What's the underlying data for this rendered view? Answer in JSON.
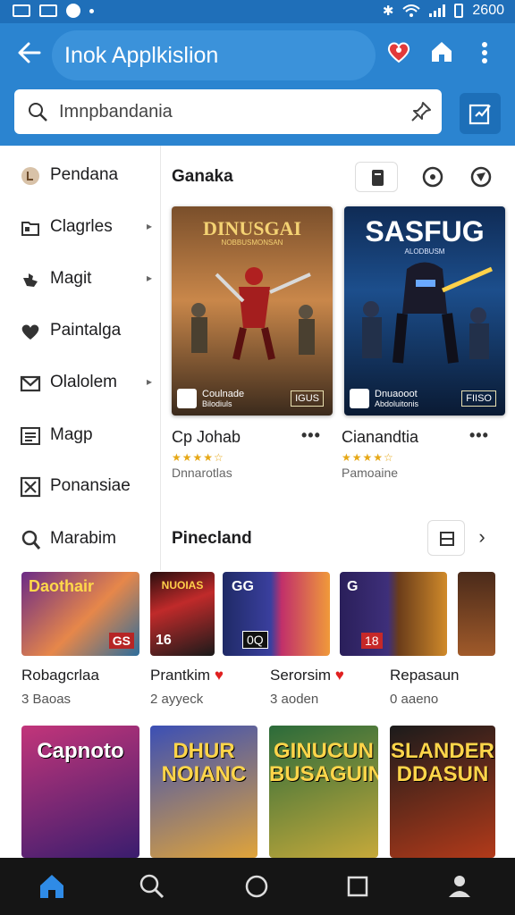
{
  "status_bar": {
    "time": "2600"
  },
  "app_bar": {
    "title": "Inok Applkislion"
  },
  "search": {
    "placeholder": "Imnpbandania"
  },
  "sidebar": {
    "items": [
      {
        "label": "Pendana",
        "icon": "circle-badge-icon",
        "chevron": false
      },
      {
        "label": "Clagrles",
        "icon": "folder-icon",
        "chevron": true
      },
      {
        "label": "Magit",
        "icon": "puzzle-icon",
        "chevron": true
      },
      {
        "label": "Paintalga",
        "icon": "heart-icon",
        "chevron": false
      },
      {
        "label": "Olalolem",
        "icon": "mail-icon",
        "chevron": true
      },
      {
        "label": "Magp",
        "icon": "list-icon",
        "chevron": false
      },
      {
        "label": "Ponansiae",
        "icon": "close-box-icon",
        "chevron": false
      },
      {
        "label": "Marabim",
        "icon": "user-search-icon",
        "chevron": false
      }
    ]
  },
  "section_1": {
    "title": "Ganaka",
    "cards": [
      {
        "art_title": "DINUSGAI",
        "art_subtitle": "NOBBUSMONSAN",
        "badge": "Coulnade",
        "badge_sub": "Bilodiuls",
        "tag": "IGUS",
        "name": "Cp Johab",
        "rating": 4.5,
        "sub": "Dnnarotlas",
        "icon": "warrior-art"
      },
      {
        "art_title": "SASFUG",
        "art_subtitle": "ALODBUSM",
        "badge": "Dnuaooot",
        "badge_sub": "Abdoluitonis",
        "tag": "FIISO",
        "name": "Cianandtia",
        "rating": 4.5,
        "sub": "Pamoaine",
        "icon": "assassin-art"
      }
    ]
  },
  "section_2": {
    "title": "Pinecland",
    "items": [
      {
        "label": "Robagcrlaa",
        "sub": "3 Baoas",
        "heart": false,
        "art_title": "Daothair",
        "tag": "GS"
      },
      {
        "label": "Prantkim",
        "sub": "2 ayyeck",
        "heart": true,
        "art_title": "NUOIAS",
        "tag": "16"
      },
      {
        "label": "Serorsim",
        "sub": "3 aoden",
        "heart": true,
        "art_title": "GG",
        "tag": "0Q"
      },
      {
        "label": "Repasaun",
        "sub": "0 aaeno",
        "heart": false,
        "art_title": "G",
        "tag": "18"
      }
    ]
  },
  "posters": [
    {
      "title": "Capnoto",
      "colors": [
        "#c2357a",
        "#3a1d6e"
      ]
    },
    {
      "title": "DHUR NOIANC",
      "colors": [
        "#3b4fb5",
        "#e0a43a"
      ]
    },
    {
      "title": "GINUCUN BUSAGUIN",
      "colors": [
        "#2b6b3a",
        "#c6a93a"
      ]
    },
    {
      "title": "SLANDER DDASUN",
      "colors": [
        "#1b1b1b",
        "#b23a1a"
      ]
    }
  ],
  "nav": {
    "items": [
      "home-icon",
      "search-icon",
      "circle-icon",
      "square-icon",
      "profile-icon"
    ]
  }
}
